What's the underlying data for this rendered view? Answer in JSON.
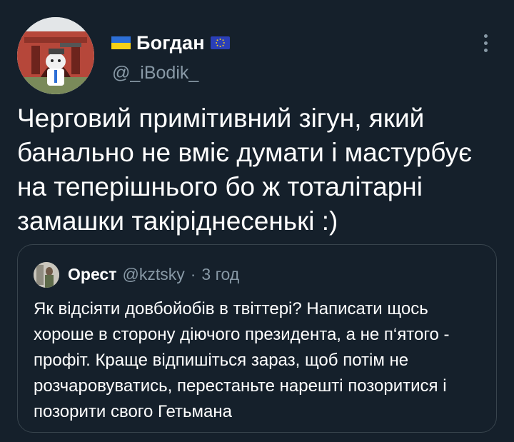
{
  "tweet": {
    "author": {
      "name": "Богдан",
      "handle": "@_iBodik_",
      "name_prefix_icon": "ukraine-flag-icon",
      "name_suffix_icon": "eu-flag-icon"
    },
    "text": "Черговий примітивний зігун, який банально не вміє думати і мастурбує на теперішнього бо ж тоталітарні замашки такіріднесенькі :)",
    "more_icon": "more-options-icon"
  },
  "quoted_tweet": {
    "author_name": "Орест",
    "author_handle": "@kztsky",
    "separator": "·",
    "time": "3 год",
    "text": "Як відсіяти довбойобів в твіттері? Написати щось хороше в сторону діючого президента, а не п‘ятого - профіт. Краще відпишіться зараз, щоб потім не розчаровуватись, перестаньте нарешті позоритися і позорити свого Гетьмана"
  },
  "colors": {
    "background": "#15202b",
    "text_primary": "#ffffff",
    "text_secondary": "#8899a6",
    "border": "#38444d"
  }
}
